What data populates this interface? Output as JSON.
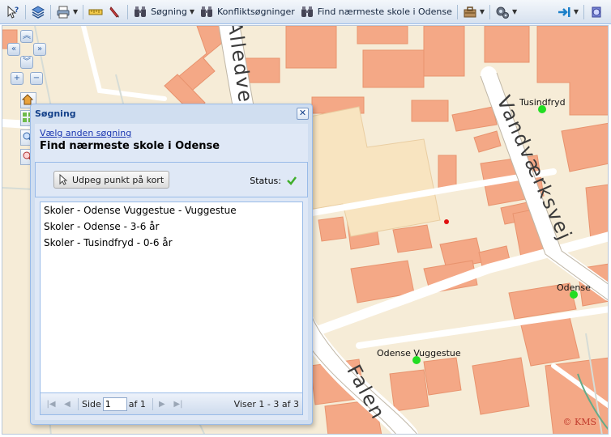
{
  "toolbar": {
    "search_label": "Søgning",
    "conflict_label": "Konfliktsøgninger",
    "nearest_school_label": "Find nærmeste skole i Odense"
  },
  "map": {
    "roads": {
      "vandvaerksvej": "Vandværksvej",
      "falen": "Falen",
      "alledvej": "Alledve"
    },
    "pois": [
      {
        "name": "Tusindfryd"
      },
      {
        "name": "Odense"
      },
      {
        "name": "Odense Vuggestue"
      }
    ],
    "copyright": "© KMS",
    "colors": {
      "background": "#f6ecd7",
      "building": "#f4a886",
      "road": "#ffffff",
      "poi": "#22dd22",
      "point": "#e01010"
    }
  },
  "dialog": {
    "title": "Søgning",
    "other_search_link": "Vælg anden søgning",
    "heading": "Find nærmeste skole i Odense",
    "pick_button_label": "Udpeg punkt på kort",
    "status_label": "Status:",
    "results": [
      "Skoler - Odense Vuggestue - Vuggestue",
      "Skoler - Odense - 3-6 år",
      "Skoler - Tusindfryd - 0-6 år"
    ],
    "pager": {
      "page_label": "Side",
      "page_value": "1",
      "of_label": "af 1",
      "info": "Viser 1 - 3 af 3"
    }
  }
}
